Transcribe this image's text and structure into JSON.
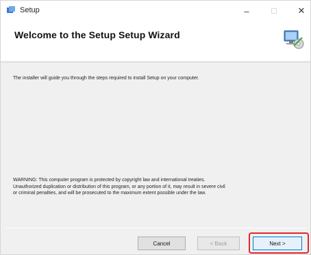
{
  "window": {
    "title": "Setup",
    "icons": {
      "app": "setup-app-icon",
      "minimize": "minimize-icon",
      "maximize": "maximize-icon",
      "close": "close-icon"
    },
    "glyphs": {
      "minimize": "–",
      "maximize": "☐",
      "close": "✕"
    }
  },
  "header": {
    "title": "Welcome to the Setup Setup Wizard",
    "graphic": "computer-install-icon"
  },
  "body": {
    "intro": "The installer will guide you through the steps required to install Setup on your computer.",
    "warning": [
      "WARNING: This computer program is protected by copyright law and international treaties.",
      "Unauthorized duplication or distribution of this program, or any portion of it, may result in severe civil",
      "or criminal penalties, and will be prosecuted to the maximum extent possible under the law."
    ]
  },
  "buttons": {
    "cancel": "Cancel",
    "back": "< Back",
    "next": "Next >"
  },
  "colors": {
    "highlight": "#e0262a",
    "focus_border": "#0078d7"
  }
}
